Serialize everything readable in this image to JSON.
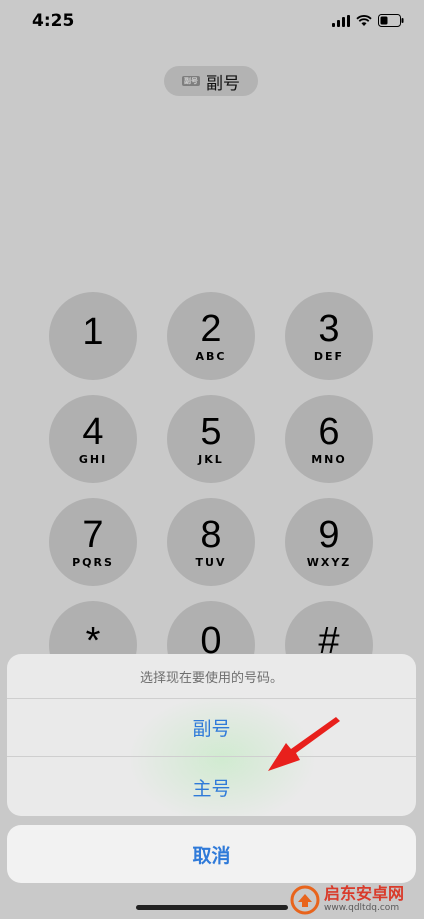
{
  "status_bar": {
    "time": "4:25"
  },
  "sim_indicator": {
    "badge": "副号",
    "label": "副号"
  },
  "keypad": [
    {
      "digit": "1",
      "letters": ""
    },
    {
      "digit": "2",
      "letters": "ABC"
    },
    {
      "digit": "3",
      "letters": "DEF"
    },
    {
      "digit": "4",
      "letters": "GHI"
    },
    {
      "digit": "5",
      "letters": "JKL"
    },
    {
      "digit": "6",
      "letters": "MNO"
    },
    {
      "digit": "7",
      "letters": "PQRS"
    },
    {
      "digit": "8",
      "letters": "TUV"
    },
    {
      "digit": "9",
      "letters": "WXYZ"
    },
    {
      "digit": "*",
      "letters": ""
    },
    {
      "digit": "0",
      "letters": ""
    },
    {
      "digit": "#",
      "letters": ""
    }
  ],
  "action_sheet": {
    "title": "选择现在要使用的号码。",
    "options": [
      "副号",
      "主号"
    ],
    "cancel": "取消"
  },
  "annotation": {
    "arrow_color": "#e8201c"
  },
  "watermark": {
    "name": "启东安卓网",
    "url": "www.qdltdq.com"
  },
  "colors": {
    "accent": "#2f7ad9",
    "background": "#c9c9c9",
    "key": "#b0b0b0"
  }
}
